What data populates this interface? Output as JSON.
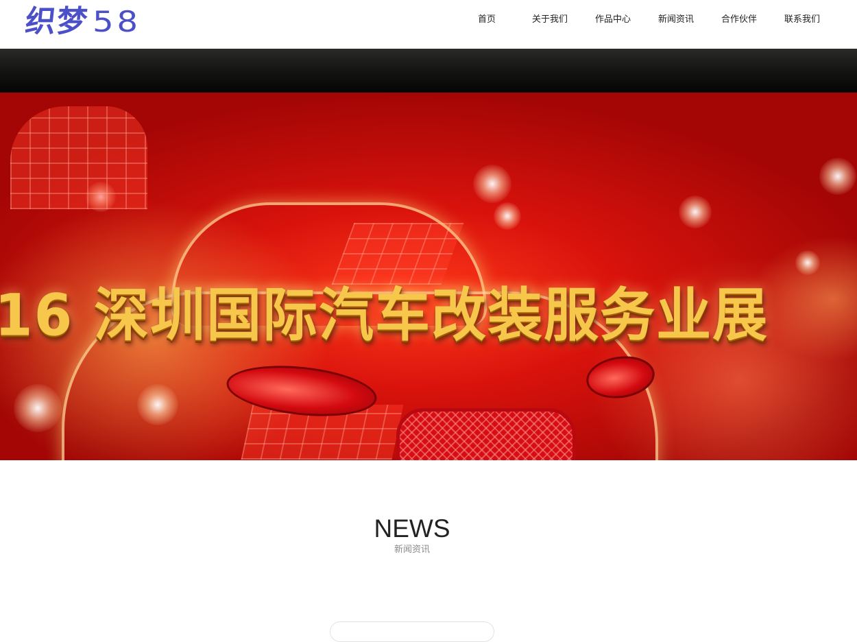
{
  "header": {
    "logo": {
      "text_cn": "织梦",
      "text_num": "58",
      "color": "#4b4fc8"
    },
    "nav": [
      {
        "label": "首页"
      },
      {
        "label": "关于我们"
      },
      {
        "label": "作品中心"
      },
      {
        "label": "新闻资讯"
      },
      {
        "label": "合作伙伴"
      },
      {
        "label": "联系我们"
      }
    ]
  },
  "banner": {
    "caption": "16 深圳国际汽车改装服务业展",
    "colors": {
      "primary": "#d8120c",
      "caption": "#f6c74a"
    }
  },
  "news": {
    "title": "NEWS",
    "subtitle": "新闻资讯"
  }
}
